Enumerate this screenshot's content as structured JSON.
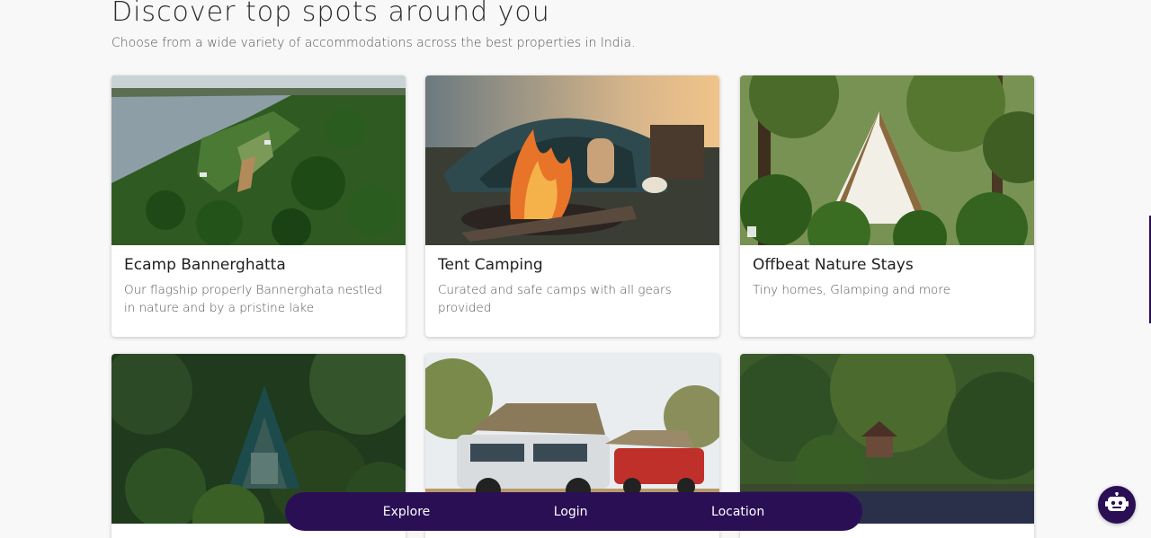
{
  "header": {
    "title": "Discover top spots around you",
    "subtitle": "Choose from a wide variety of accommodations across the best properties in India."
  },
  "cards": [
    {
      "title": "Ecamp Bannerghatta",
      "description": "Our flagship properly Bannerghata nestled in nature and by a pristine lake",
      "image": "aerial-lake-forest"
    },
    {
      "title": "Tent Camping",
      "description": "Curated and safe camps with all gears provided",
      "image": "campfire-tent"
    },
    {
      "title": "Offbeat Nature Stays",
      "description": "Tiny homes, Glamping and more",
      "image": "glamping-tent-forest"
    },
    {
      "title": "",
      "description": "",
      "image": "a-frame-cabin-jungle"
    },
    {
      "title": "",
      "description": "",
      "image": "rooftop-tent-suvs"
    },
    {
      "title": "",
      "description": "",
      "image": "lakeside-cabin"
    }
  ],
  "bottom_nav": {
    "items": [
      "Explore",
      "Login",
      "Location"
    ]
  },
  "chatbot": {
    "icon": "robot-icon"
  },
  "colors": {
    "nav_bg": "#2a0f55",
    "page_bg": "#f8f8f8"
  }
}
